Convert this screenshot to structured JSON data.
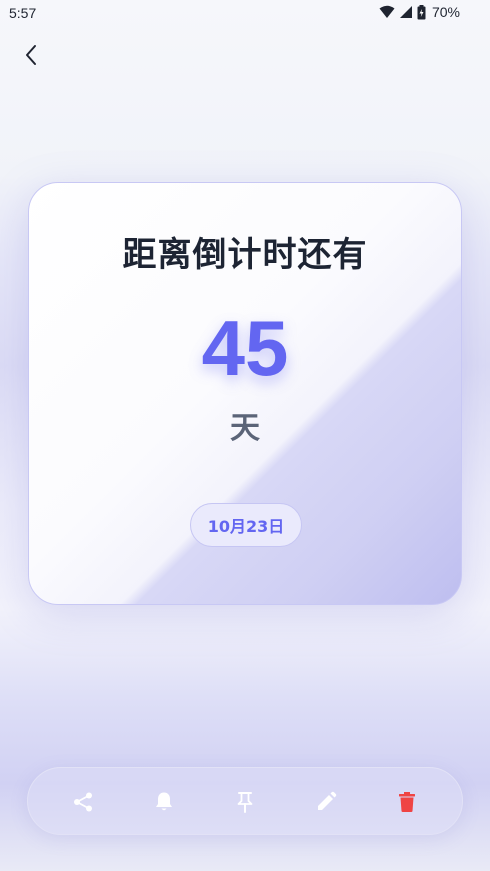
{
  "status_bar": {
    "time": "5:57",
    "battery": "70%"
  },
  "card": {
    "title": "距离倒计时还有",
    "days_value": "45",
    "days_unit": "天",
    "target_date": "10月23日"
  },
  "colors": {
    "accent": "#6366f1",
    "delete": "#ef4444",
    "toolbar_icon": "#ffffff",
    "title": "#1d2433"
  },
  "toolbar": {
    "icons": [
      "share-icon",
      "bell-icon",
      "pin-icon",
      "edit-icon",
      "trash-icon"
    ]
  }
}
